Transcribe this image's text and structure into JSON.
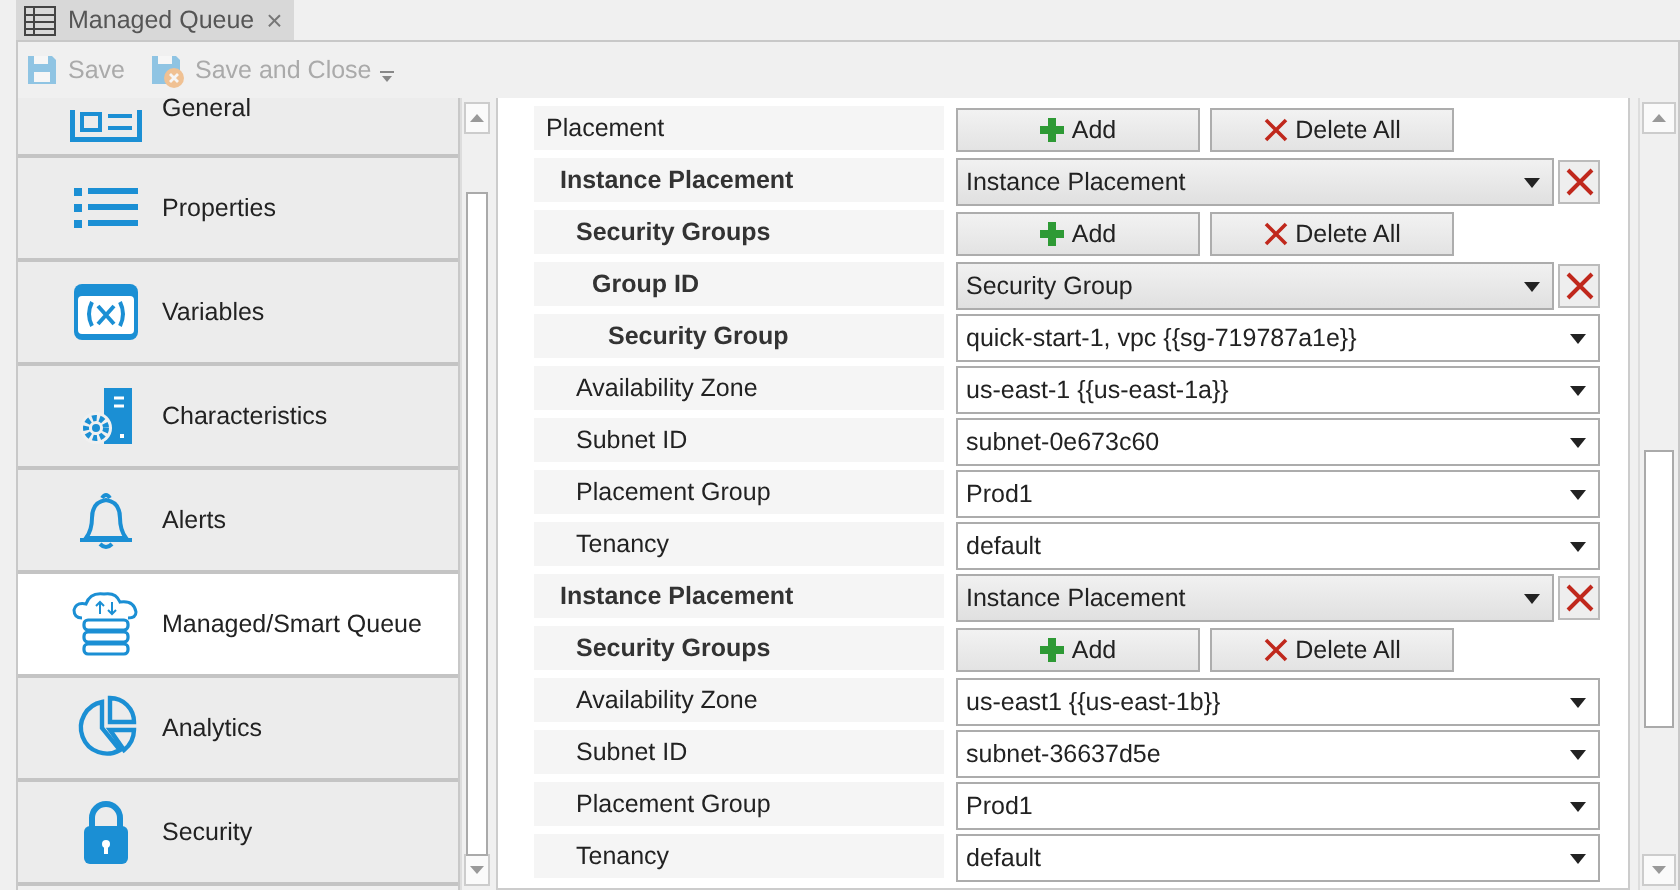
{
  "tab": {
    "title": "Managed Queue",
    "close": "×"
  },
  "toolbar": [
    {
      "kind": "save",
      "label": "Save",
      "disabled": true
    },
    {
      "kind": "save-close",
      "label": "Save and Close",
      "disabled": true
    }
  ],
  "sidebar": {
    "items": [
      {
        "kind": "general",
        "label": "General",
        "selected": false
      },
      {
        "kind": "properties",
        "label": "Properties",
        "selected": false
      },
      {
        "kind": "variables",
        "label": "Variables",
        "selected": false
      },
      {
        "kind": "characteristics",
        "label": "Characteristics",
        "selected": false
      },
      {
        "kind": "alerts",
        "label": "Alerts",
        "selected": false
      },
      {
        "kind": "queue",
        "label": "Managed/Smart Queue",
        "selected": true
      },
      {
        "kind": "analytics",
        "label": "Analytics",
        "selected": false
      },
      {
        "kind": "security",
        "label": "Security",
        "selected": false
      }
    ]
  },
  "properties": [
    {
      "label": "Placement",
      "bold": false,
      "kind": "buttons",
      "buttons": [
        {
          "kind": "add",
          "label": "Add"
        },
        {
          "kind": "delete",
          "label": "Delete All"
        }
      ],
      "children": [
        {
          "label": "Instance Placement",
          "bold": true,
          "kind": "combo",
          "value": "Instance Placement",
          "children": [
            {
              "label": "Security Groups",
              "bold": true,
              "kind": "buttons",
              "buttons": [
                {
                  "kind": "add",
                  "label": "Add"
                },
                {
                  "kind": "delete",
                  "label": "Delete All"
                }
              ],
              "children": [
                {
                  "label": "Group ID",
                  "bold": true,
                  "kind": "combo",
                  "value": "Security Group",
                  "children": [
                    {
                      "label": "Security Group",
                      "bold": true,
                      "kind": "dropdown",
                      "value": "quick-start-1, vpc {{sg-719787a1e}}"
                    }
                  ]
                }
              ]
            },
            {
              "label": "Availability Zone",
              "bold": false,
              "kind": "dropdown",
              "value": "us-east-1 {{us-east-1a}}"
            },
            {
              "label": "Subnet ID",
              "bold": false,
              "kind": "dropdown",
              "value": "subnet-0e673c60"
            },
            {
              "label": "Placement Group",
              "bold": false,
              "kind": "dropdown",
              "value": "Prod1"
            },
            {
              "label": "Tenancy",
              "bold": false,
              "kind": "dropdown",
              "value": "default"
            }
          ]
        },
        {
          "label": "Instance Placement",
          "bold": true,
          "kind": "combo",
          "value": "Instance Placement",
          "children": [
            {
              "label": "Security Groups",
              "bold": true,
              "kind": "buttons",
              "buttons": [
                {
                  "kind": "add",
                  "label": "Add"
                },
                {
                  "kind": "delete",
                  "label": "Delete All"
                }
              ]
            },
            {
              "label": "Availability Zone",
              "bold": false,
              "kind": "dropdown",
              "value": "us-east1 {{us-east-1b}}"
            },
            {
              "label": "Subnet ID",
              "bold": false,
              "kind": "dropdown",
              "value": "subnet-36637d5e"
            },
            {
              "label": "Placement Group",
              "bold": false,
              "kind": "dropdown",
              "value": "Prod1"
            },
            {
              "label": "Tenancy",
              "bold": false,
              "kind": "dropdown",
              "value": "default"
            }
          ]
        }
      ]
    }
  ]
}
